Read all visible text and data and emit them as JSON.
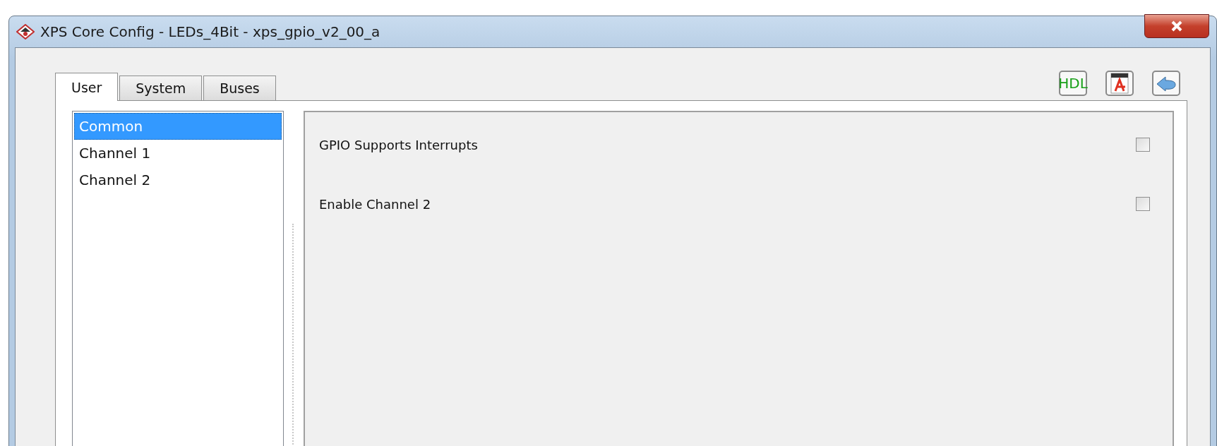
{
  "window": {
    "title": "XPS Core Config - LEDs_4Bit - xps_gpio_v2_00_a"
  },
  "tabs": [
    {
      "label": "User",
      "selected": true
    },
    {
      "label": "System",
      "selected": false
    },
    {
      "label": "Buses",
      "selected": false
    }
  ],
  "toolbar": [
    {
      "kind": "hdl",
      "label": "HDL"
    },
    {
      "kind": "pdf"
    },
    {
      "kind": "back"
    }
  ],
  "sidebar": {
    "items": [
      {
        "label": "Common",
        "selected": true
      },
      {
        "label": "Channel 1",
        "selected": false
      },
      {
        "label": "Channel 2",
        "selected": false
      }
    ]
  },
  "options": [
    {
      "label": "GPIO Supports Interrupts",
      "checked": false
    },
    {
      "label": "Enable Channel 2",
      "checked": false
    }
  ]
}
